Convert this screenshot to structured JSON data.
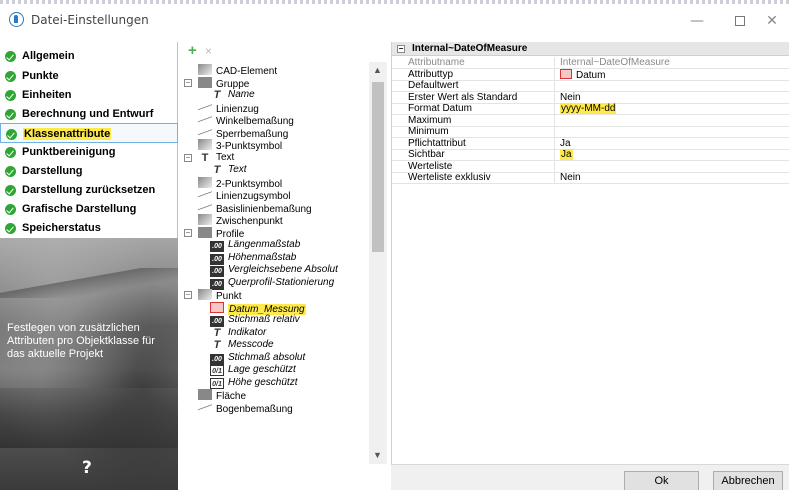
{
  "window": {
    "title": "Datei-Einstellungen",
    "minimize": "—",
    "close": "✕"
  },
  "nav": {
    "items": [
      {
        "label": "Allgemein"
      },
      {
        "label": "Punkte"
      },
      {
        "label": "Einheiten"
      },
      {
        "label": "Berechnung und Entwurf"
      },
      {
        "label": "Klassenattribute",
        "active": true
      },
      {
        "label": "Punktbereinigung"
      },
      {
        "label": "Darstellung"
      },
      {
        "label": "Darstellung zurücksetzen"
      },
      {
        "label": "Grafische Darstellung"
      },
      {
        "label": "Speicherstatus"
      }
    ],
    "description": "Festlegen von zusätzlichen Attributen pro Objektklasse für das aktuelle Projekt",
    "help": "?"
  },
  "tree": {
    "toolbar": {
      "add": "+",
      "delete": "×"
    },
    "nodes": [
      {
        "label": "CAD-Element",
        "icon": "cad-icon"
      },
      {
        "label": "Gruppe",
        "icon": "group-icon"
      },
      {
        "label": "Name",
        "icon": "text-icon"
      },
      {
        "label": "Linienzug",
        "icon": "polyline-icon"
      },
      {
        "label": "Winkelbemaßung",
        "icon": "angle-dimension-icon"
      },
      {
        "label": "Sperrbemaßung",
        "icon": "dimension-icon"
      },
      {
        "label": "3-Punktsymbol",
        "icon": "symbol-icon"
      },
      {
        "label": "Text",
        "icon": "text-icon"
      },
      {
        "label": "Text",
        "icon": "text-icon"
      },
      {
        "label": "2-Punktsymbol",
        "icon": "symbol-icon"
      },
      {
        "label": "Linienzugsymbol",
        "icon": "polyline-symbol-icon"
      },
      {
        "label": "Basislinienbemaßung",
        "icon": "baseline-dimension-icon"
      },
      {
        "label": "Zwischenpunkt",
        "icon": "intermediate-point-icon"
      },
      {
        "label": "Profile",
        "icon": "profile-icon"
      },
      {
        "label": "Längenmaßstab",
        "icon": "number-icon"
      },
      {
        "label": "Höhenmaßstab",
        "icon": "number-icon"
      },
      {
        "label": "Vergleichsebene Absolut",
        "icon": "number-icon"
      },
      {
        "label": "Querprofil-Stationierung",
        "icon": "number-icon"
      },
      {
        "label": "Punkt",
        "icon": "point-icon"
      },
      {
        "label": "Datum_Messung",
        "icon": "date-icon",
        "highlight": true
      },
      {
        "label": "Stichmaß relativ",
        "icon": "number-icon"
      },
      {
        "label": "Indikator",
        "icon": "text-icon"
      },
      {
        "label": "Messcode",
        "icon": "text-icon"
      },
      {
        "label": "Stichmaß absolut",
        "icon": "number-icon"
      },
      {
        "label": "Lage geschützt",
        "icon": "boolean-icon"
      },
      {
        "label": "Höhe geschützt",
        "icon": "boolean-icon"
      },
      {
        "label": "Fläche",
        "icon": "area-icon"
      },
      {
        "label": "Bogenbemaßung",
        "icon": "arc-dimension-icon"
      }
    ]
  },
  "properties": {
    "header": "Internal~DateOfMeasure",
    "rows": [
      {
        "name": "Attributname",
        "value": "Internal~DateOfMeasure",
        "readonly": true
      },
      {
        "name": "Attributtyp",
        "value": "Datum",
        "icon": "date-icon"
      },
      {
        "name": "Defaultwert",
        "value": ""
      },
      {
        "name": "Erster Wert als Standard",
        "value": "Nein"
      },
      {
        "name": "Format Datum",
        "value": "yyyy-MM-dd",
        "highlight": true
      },
      {
        "name": "Maximum",
        "value": ""
      },
      {
        "name": "Minimum",
        "value": ""
      },
      {
        "name": "Pflichtattribut",
        "value": "Ja"
      },
      {
        "name": "Sichtbar",
        "value": "Ja",
        "highlight": true
      },
      {
        "name": "Werteliste",
        "value": ""
      },
      {
        "name": "Werteliste exklusiv",
        "value": "Nein"
      }
    ]
  },
  "buttons": {
    "ok": "Ok",
    "cancel": "Abbrechen"
  }
}
